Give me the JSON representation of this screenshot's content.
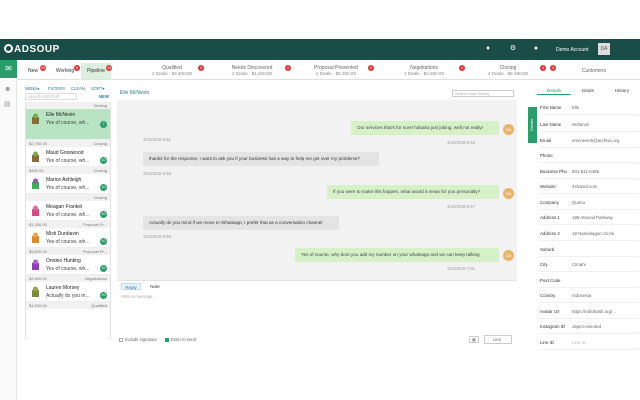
{
  "app": {
    "logo": "ADSOUP",
    "account_label": "Demo Account",
    "avatar_initials": "DA"
  },
  "topbar_icons": [
    "bell-icon",
    "gear-icon",
    "globe-icon"
  ],
  "left_tabs": [
    {
      "label": "New",
      "badge": "23"
    },
    {
      "label": "Working",
      "badge": "6"
    },
    {
      "label": "Pipeline",
      "badge": "13"
    }
  ],
  "pipeline": [
    {
      "name": "Qualified",
      "sub": "2 Deals · $3,400.00",
      "badge": "2"
    },
    {
      "name": "Needs Discovered",
      "sub": "2 Deals · $1,200.00",
      "badge": "2"
    },
    {
      "name": "Proposal Presented",
      "sub": "2 Deals · $9,300.00",
      "badge": "2"
    },
    {
      "name": "Negotiations",
      "sub": "1 Deals · $2,550.00",
      "badge": "1"
    },
    {
      "name": "Closing",
      "sub": "4 Deals · $9,480.00",
      "badge": "4"
    },
    {
      "name": "Customers",
      "sub": "",
      "badge": "2"
    }
  ],
  "list_controls": {
    "menu": "MENU▾",
    "filters": "FILTERS",
    "clean": "CLEAN",
    "sort": "SORT▾",
    "search_placeholder": "Search ADSOUP",
    "new_label": "NEW"
  },
  "contacts": [
    {
      "group": "Closing",
      "amount": "",
      "name": "Elle McNevin",
      "message": "Yes of course, wh...",
      "count": "7",
      "selected": true
    },
    {
      "group": "Closing",
      "amount": "$2,750.00",
      "name": "Maud Grisswood",
      "message": "Yes of course, wh...",
      "count": "10",
      "selected": false
    },
    {
      "group": "Closing",
      "amount": "$480.00",
      "name": "Marice Ashleigh",
      "message": "Yes of course, wh...",
      "count": "10",
      "selected": false
    },
    {
      "group": "Closing",
      "amount": "",
      "name": "Meagan Frankel",
      "message": "Yes of course, wh...",
      "count": "10",
      "selected": false
    },
    {
      "group": "Proposal Pr...",
      "amount": "$1,200.00",
      "name": "Misti Dunbavin",
      "message": "Yes of course, wh...",
      "count": "10",
      "selected": false
    },
    {
      "group": "Proposal Pr...",
      "amount": "$5,600.00",
      "name": "Onoleo Hunting",
      "message": "Yes of course, wh...",
      "count": "10",
      "selected": false
    },
    {
      "group": "Negotiations",
      "amount": "$2,600.00",
      "name": "Lauren Morsey",
      "message": "Actually do you m...",
      "count": "10",
      "selected": false
    },
    {
      "group": "Qualified",
      "amount": "$1,200.00",
      "name": "",
      "message": "",
      "count": "",
      "selected": false
    }
  ],
  "chat": {
    "contact_name": "Elle McNevin",
    "search_placeholder": "Search chat history",
    "messages": [
      {
        "dir": "in",
        "text": "",
        "time": "3/31/2018 6:51"
      },
      {
        "dir": "out",
        "text": "Our services that's for sure! hahaha just joking, well not really!",
        "time": "3/31/2018 6:53",
        "initials": "DA"
      },
      {
        "dir": "in",
        "text": "thanks for the response, I want to ask you if your business has a way to help me get over my problems?",
        "time": "3/31/2018 6:55"
      },
      {
        "dir": "out",
        "text": "If you were to make this happen, what would it mean for you personally?",
        "time": "3/31/2018 6:57",
        "initials": "DA"
      },
      {
        "dir": "in",
        "text": "Actually do you mind if we move to Whatsapp, I prefer that as a conversation channel",
        "time": "3/31/2018 6:59"
      },
      {
        "dir": "out",
        "text": "Yes of course, why dont you add my number on your whatsapp and we can keep talking",
        "time": "3/31/2018 7:01",
        "initials": "DA"
      }
    ]
  },
  "composer": {
    "tabs": [
      "Reply",
      "Note"
    ],
    "placeholder": "Write a message...",
    "include_signature": "Include signature",
    "enter_to_send": "Enter to send",
    "send_channel": "Line"
  },
  "details": {
    "tabs": [
      "Details",
      "Deals",
      "History"
    ],
    "side_label": "Details",
    "fields": [
      {
        "label": "First Name",
        "value": "Elle"
      },
      {
        "label": "Last Name",
        "value": "McNevin"
      },
      {
        "label": "Email",
        "value": "emcnevin0@archive.org"
      },
      {
        "label": "Phone",
        "value": ""
      },
      {
        "label": "Business Pho",
        "value": "801-511-6495"
      },
      {
        "label": "Website",
        "value": "4shared.com"
      },
      {
        "label": "Company",
        "value": "Quimu"
      },
      {
        "label": "Address 1",
        "value": "189 Atwood Parkway"
      },
      {
        "label": "Address 2",
        "value": "18 Namekagon Circle"
      },
      {
        "label": "Suburb",
        "value": ""
      },
      {
        "label": "City",
        "value": "Cimahi"
      },
      {
        "label": "Post Code",
        "value": ""
      },
      {
        "label": "Country",
        "value": "Indonesia"
      },
      {
        "label": "Avatar Url",
        "value": "https://robohash.org/..."
      },
      {
        "label": "Instagram ID",
        "value": "object-oriented"
      },
      {
        "label": "Line ID",
        "value": "Line ID"
      }
    ]
  },
  "colors": {
    "topbar": "#1a4d47",
    "accent": "#2a9d6a",
    "badge": "#d9383a",
    "out_bubble": "#d6f0c8",
    "in_bubble": "#e4e4e4"
  }
}
